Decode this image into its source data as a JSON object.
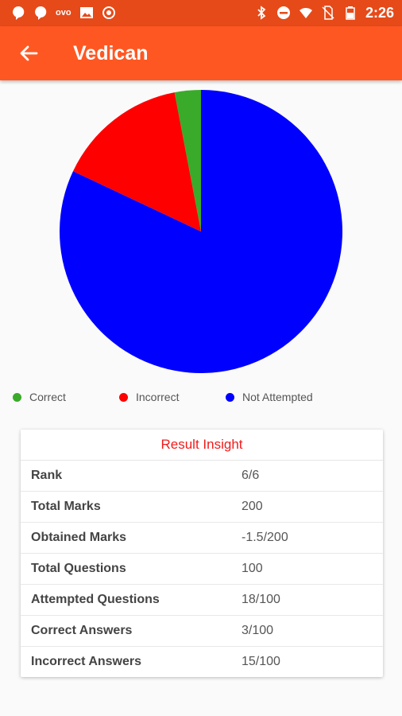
{
  "status_bar": {
    "time": "2:26",
    "icons": [
      "chat-bubble-icon",
      "chat-bubble-icon",
      "ovo-icon",
      "image-icon",
      "target-icon",
      "bluetooth-icon",
      "do-not-disturb-icon",
      "wifi-icon",
      "no-sim-icon",
      "battery-icon"
    ],
    "ovo_label": "ovo"
  },
  "app_bar": {
    "title": "Vedican",
    "back_icon": "arrow-back-icon"
  },
  "chart_data": {
    "type": "pie",
    "slices": [
      {
        "name": "Correct",
        "value": 3,
        "color": "#3aaa2a"
      },
      {
        "name": "Incorrect",
        "value": 15,
        "color": "#ff0000"
      },
      {
        "name": "Not Attempted",
        "value": 82,
        "color": "#0000ff"
      }
    ],
    "legend": [
      {
        "label": "Correct",
        "color": "#3aaa2a"
      },
      {
        "label": "Incorrect",
        "color": "#ff0000"
      },
      {
        "label": "Not Attempted",
        "color": "#0000ff"
      }
    ],
    "legend_position": "bottom"
  },
  "result": {
    "title": "Result Insight",
    "rows": [
      {
        "label": "Rank",
        "value": "6/6"
      },
      {
        "label": "Total Marks",
        "value": "200"
      },
      {
        "label": "Obtained Marks",
        "value": "-1.5/200"
      },
      {
        "label": "Total Questions",
        "value": "100"
      },
      {
        "label": "Attempted Questions",
        "value": "18/100"
      },
      {
        "label": "Correct Answers",
        "value": "3/100"
      },
      {
        "label": "Incorrect Answers",
        "value": "15/100"
      }
    ]
  }
}
